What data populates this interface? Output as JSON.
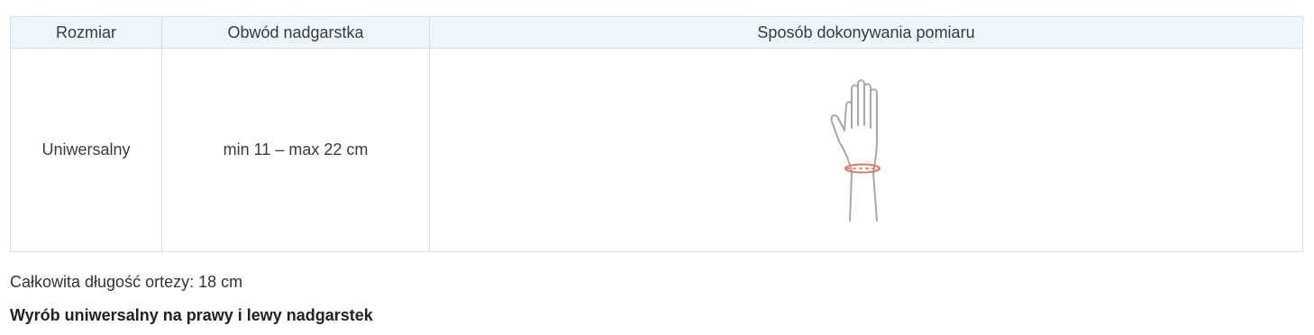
{
  "table": {
    "headers": {
      "size": "Rozmiar",
      "circumference": "Obwód nadgarstka",
      "method": "Sposób dokonywania pomiaru"
    },
    "row": {
      "size": "Uniwersalny",
      "circumference": "min 11 – max 22 cm",
      "method_icon": "hand-wrist-measurement-icon"
    }
  },
  "notes": {
    "total_length": "Całkowita długość ortezy: 18 cm",
    "universal": "Wyrób uniwersalny na prawy i lewy nadgarstek"
  },
  "colors": {
    "header_bg": "#eef6fd",
    "border": "#dedede",
    "hand_outline": "#a8a8a8",
    "measure_line": "#e8735a"
  }
}
